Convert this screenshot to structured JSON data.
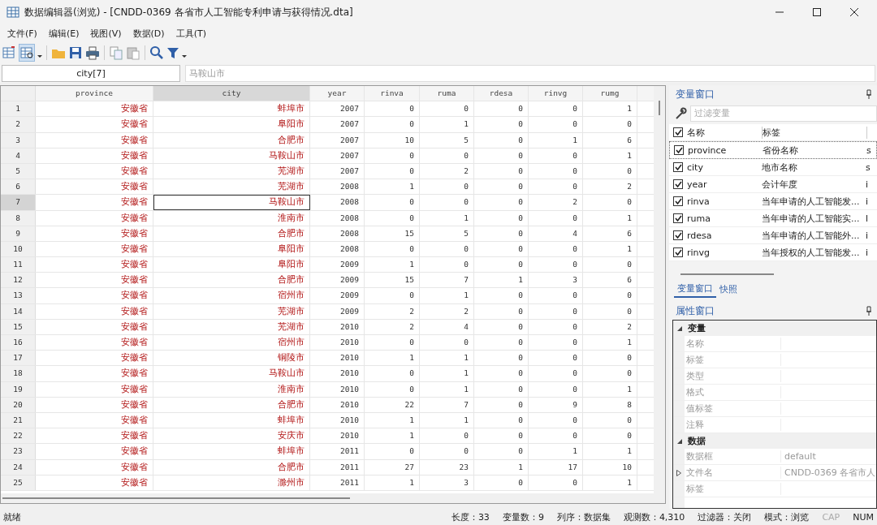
{
  "window": {
    "title": "数据编辑器(浏览) - [CNDD-0369 各省市人工智能专利申请与获得情况.dta]"
  },
  "menu": [
    "文件(F)",
    "编辑(E)",
    "视图(V)",
    "数据(D)",
    "工具(T)"
  ],
  "cell_bar": {
    "reference": "city[7]",
    "value": "马鞍山市"
  },
  "table": {
    "columns": [
      {
        "label": "province",
        "selected": false
      },
      {
        "label": "city",
        "selected": true
      },
      {
        "label": "year",
        "selected": false
      },
      {
        "label": "rinva",
        "selected": false
      },
      {
        "label": "ruma",
        "selected": false
      },
      {
        "label": "rdesa",
        "selected": false
      },
      {
        "label": "rinvg",
        "selected": false
      },
      {
        "label": "rumg",
        "selected": false
      }
    ],
    "rows": [
      {
        "n": "1",
        "selected": false,
        "cells": [
          "安徽省",
          "蚌埠市",
          "2007",
          "0",
          "0",
          "0",
          "0",
          "1"
        ]
      },
      {
        "n": "2",
        "selected": false,
        "cells": [
          "安徽省",
          "阜阳市",
          "2007",
          "0",
          "1",
          "0",
          "0",
          "0"
        ]
      },
      {
        "n": "3",
        "selected": false,
        "cells": [
          "安徽省",
          "合肥市",
          "2007",
          "10",
          "5",
          "0",
          "1",
          "6"
        ]
      },
      {
        "n": "4",
        "selected": false,
        "cells": [
          "安徽省",
          "马鞍山市",
          "2007",
          "0",
          "0",
          "0",
          "0",
          "1"
        ]
      },
      {
        "n": "5",
        "selected": false,
        "cells": [
          "安徽省",
          "芜湖市",
          "2007",
          "0",
          "2",
          "0",
          "0",
          "0"
        ]
      },
      {
        "n": "6",
        "selected": false,
        "cells": [
          "安徽省",
          "芜湖市",
          "2008",
          "1",
          "0",
          "0",
          "0",
          "2"
        ]
      },
      {
        "n": "7",
        "selected": true,
        "cells": [
          "安徽省",
          "马鞍山市",
          "2008",
          "0",
          "0",
          "0",
          "2",
          "0"
        ]
      },
      {
        "n": "8",
        "selected": false,
        "cells": [
          "安徽省",
          "淮南市",
          "2008",
          "0",
          "1",
          "0",
          "0",
          "1"
        ]
      },
      {
        "n": "9",
        "selected": false,
        "cells": [
          "安徽省",
          "合肥市",
          "2008",
          "15",
          "5",
          "0",
          "4",
          "6"
        ]
      },
      {
        "n": "10",
        "selected": false,
        "cells": [
          "安徽省",
          "阜阳市",
          "2008",
          "0",
          "0",
          "0",
          "0",
          "1"
        ]
      },
      {
        "n": "11",
        "selected": false,
        "cells": [
          "安徽省",
          "阜阳市",
          "2009",
          "1",
          "0",
          "0",
          "0",
          "0"
        ]
      },
      {
        "n": "12",
        "selected": false,
        "cells": [
          "安徽省",
          "合肥市",
          "2009",
          "15",
          "7",
          "1",
          "3",
          "6"
        ]
      },
      {
        "n": "13",
        "selected": false,
        "cells": [
          "安徽省",
          "宿州市",
          "2009",
          "0",
          "1",
          "0",
          "0",
          "0"
        ]
      },
      {
        "n": "14",
        "selected": false,
        "cells": [
          "安徽省",
          "芜湖市",
          "2009",
          "2",
          "2",
          "0",
          "0",
          "0"
        ]
      },
      {
        "n": "15",
        "selected": false,
        "cells": [
          "安徽省",
          "芜湖市",
          "2010",
          "2",
          "4",
          "0",
          "0",
          "2"
        ]
      },
      {
        "n": "16",
        "selected": false,
        "cells": [
          "安徽省",
          "宿州市",
          "2010",
          "0",
          "0",
          "0",
          "0",
          "1"
        ]
      },
      {
        "n": "17",
        "selected": false,
        "cells": [
          "安徽省",
          "铜陵市",
          "2010",
          "1",
          "1",
          "0",
          "0",
          "0"
        ]
      },
      {
        "n": "18",
        "selected": false,
        "cells": [
          "安徽省",
          "马鞍山市",
          "2010",
          "0",
          "1",
          "0",
          "0",
          "0"
        ]
      },
      {
        "n": "19",
        "selected": false,
        "cells": [
          "安徽省",
          "淮南市",
          "2010",
          "0",
          "1",
          "0",
          "0",
          "1"
        ]
      },
      {
        "n": "20",
        "selected": false,
        "cells": [
          "安徽省",
          "合肥市",
          "2010",
          "22",
          "7",
          "0",
          "9",
          "8"
        ]
      },
      {
        "n": "21",
        "selected": false,
        "cells": [
          "安徽省",
          "蚌埠市",
          "2010",
          "1",
          "1",
          "0",
          "0",
          "0"
        ]
      },
      {
        "n": "22",
        "selected": false,
        "cells": [
          "安徽省",
          "安庆市",
          "2010",
          "1",
          "0",
          "0",
          "0",
          "0"
        ]
      },
      {
        "n": "23",
        "selected": false,
        "cells": [
          "安徽省",
          "蚌埠市",
          "2011",
          "0",
          "0",
          "0",
          "1",
          "1"
        ]
      },
      {
        "n": "24",
        "selected": false,
        "cells": [
          "安徽省",
          "合肥市",
          "2011",
          "27",
          "23",
          "1",
          "17",
          "10"
        ]
      },
      {
        "n": "25",
        "selected": false,
        "cells": [
          "安徽省",
          "滁州市",
          "2011",
          "1",
          "3",
          "0",
          "0",
          "1"
        ]
      }
    ]
  },
  "variables_panel": {
    "title": "变量窗口",
    "filter_placeholder": "过滤变量",
    "all_checked": true,
    "columns": [
      "名称",
      "标签"
    ],
    "variables": [
      {
        "name": "province",
        "label": "省份名称",
        "column_3": "s",
        "checked": true
      },
      {
        "name": "city",
        "label": "地市名称",
        "column_3": "s",
        "checked": true
      },
      {
        "name": "year",
        "label": "会计年度",
        "column_3": "i",
        "checked": true
      },
      {
        "name": "rinva",
        "label": "当年申请的人工智能发...",
        "column_3": "i",
        "checked": true
      },
      {
        "name": "ruma",
        "label": "当年申请的人工智能实...",
        "column_3": "l",
        "checked": true
      },
      {
        "name": "rdesa",
        "label": "当年申请的人工智能外...",
        "column_3": "i",
        "checked": true
      },
      {
        "name": "rinvg",
        "label": "当年授权的人工智能发...",
        "column_3": "i",
        "checked": true
      }
    ]
  },
  "panel_tabs": [
    {
      "label": "变量窗口",
      "selected": true
    },
    {
      "label": "快照",
      "selected": false
    }
  ],
  "properties_panel": {
    "title": "属性窗口",
    "sections": [
      {
        "title": "变量",
        "expanded": true,
        "rows": [
          {
            "name": "名称",
            "expandable": false
          },
          {
            "name": "标签",
            "expandable": false
          },
          {
            "name": "类型",
            "expandable": false
          },
          {
            "name": "格式",
            "expandable": false
          },
          {
            "name": "值标签",
            "expandable": false
          },
          {
            "name": "注释",
            "expandable": false
          }
        ]
      },
      {
        "title": "数据",
        "expanded": true,
        "rows": [
          {
            "name": "数据框",
            "value": "default",
            "expandable": false
          },
          {
            "name": "文件名",
            "value": "CNDD-0369 各省市人",
            "expandable": true
          },
          {
            "name": "标签",
            "expandable": false
          }
        ]
      }
    ]
  },
  "status_bar": {
    "message": "就绪",
    "items": [
      {
        "text": "长度：33",
        "disabled": false
      },
      {
        "text": "变量数：9",
        "disabled": false
      },
      {
        "text": "列序：数据集",
        "disabled": false
      },
      {
        "text": "观测数：4,310",
        "disabled": false
      },
      {
        "text": "过滤器：关闭",
        "disabled": false
      },
      {
        "text": "模式：浏览",
        "disabled": false
      },
      {
        "text": "CAP",
        "disabled": true
      },
      {
        "text": "NUM",
        "disabled": false
      }
    ]
  }
}
